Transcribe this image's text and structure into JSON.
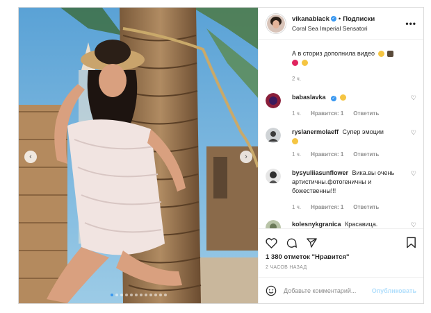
{
  "header": {
    "username": "vikanablack",
    "follow_label": "Подписки",
    "separator": "•",
    "location": "Coral Sea Imperial Sensatori",
    "more": "•••"
  },
  "caption_tail": {
    "text": "А в сториз дополнила видео",
    "time": "2 ч."
  },
  "comments": [
    {
      "username": "babaslavka",
      "text": "",
      "time": "1 ч.",
      "likes": "Нравится: 1",
      "reply": "Ответить",
      "verified": true
    },
    {
      "username": "ryslanermolaeff",
      "text": "Супер эмоции",
      "time": "1 ч.",
      "likes": "Нравится: 1",
      "reply": "Ответить",
      "verified": false
    },
    {
      "username": "bysyuliiasunflower",
      "text": "Вика.вы очень артистичны.фотогеничны и божественны!!!",
      "time": "1 ч.",
      "likes": "Нравится: 1",
      "reply": "Ответить",
      "verified": false
    },
    {
      "username": "kolesnykgranica",
      "text": "Красавица.",
      "time": "",
      "likes": "",
      "reply": "",
      "verified": false
    }
  ],
  "likes_count": "1 380 отметок \"Нравится\"",
  "post_time": "2 ЧАСОВ НАЗАД",
  "add_comment": {
    "placeholder": "Добавьте комментарий...",
    "publish_label": "Опубликовать"
  },
  "carousel": {
    "slides": 12,
    "active": 0
  },
  "colors": {
    "accent": "#3897f0",
    "publish_disabled": "#b2dffc",
    "muted": "#8e8e8e"
  }
}
